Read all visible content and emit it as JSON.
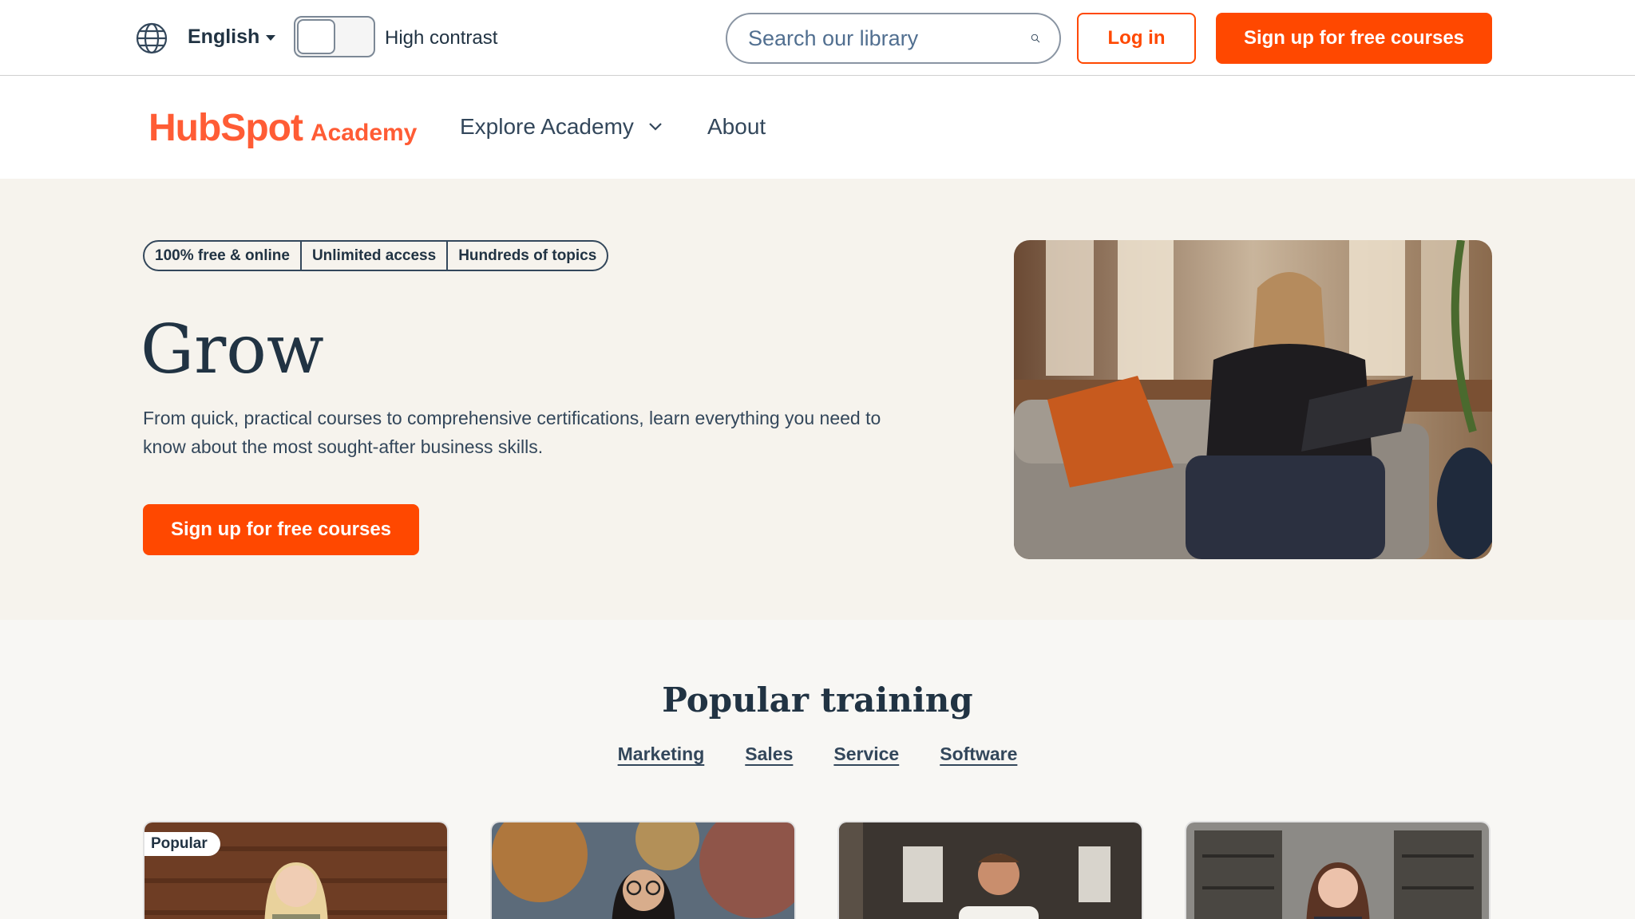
{
  "utility": {
    "language": "English",
    "high_contrast_label": "High contrast",
    "search_placeholder": "Search our library",
    "login_label": "Log in",
    "signup_label": "Sign up for free courses"
  },
  "nav": {
    "logo_main": "HubSpot",
    "logo_sub": "Academy",
    "explore_label": "Explore Academy",
    "about_label": "About"
  },
  "hero": {
    "pills": [
      "100% free & online",
      "Unlimited access",
      "Hundreds of topics"
    ],
    "title": "Grow",
    "description": "From quick, practical courses to comprehensive certifications, learn everything you need to know about the most sought-after business skills.",
    "cta_label": "Sign up for free courses"
  },
  "popular": {
    "title": "Popular training",
    "tabs": [
      "Marketing",
      "Sales",
      "Service",
      "Software"
    ],
    "badge": "Popular"
  },
  "colors": {
    "accent": "#ff4800",
    "brand": "#ff5c35",
    "text": "#213343",
    "hero_bg": "#f6f3ed"
  }
}
